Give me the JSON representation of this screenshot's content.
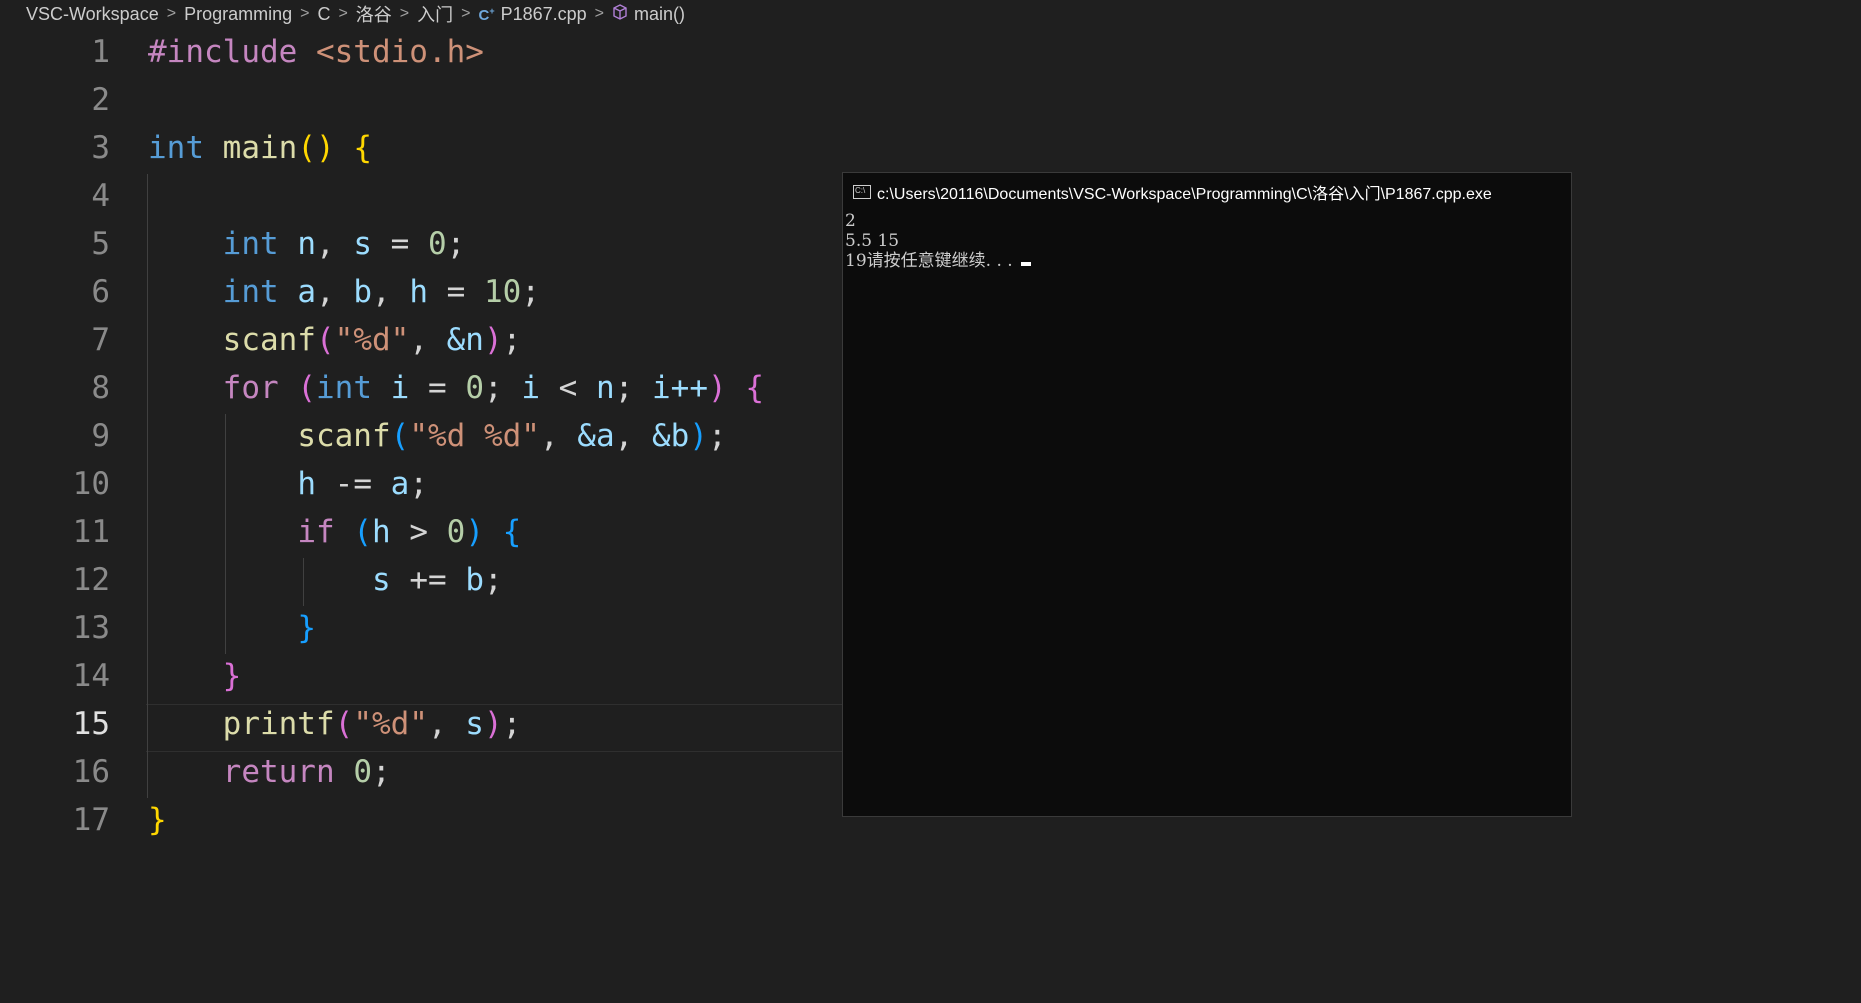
{
  "breadcrumb": {
    "items": [
      "VSC-Workspace",
      "Programming",
      "C",
      "洛谷",
      "入门",
      "P1867.cpp",
      "main()"
    ],
    "separator": ">",
    "file_icon": "cpp-file-icon",
    "symbol_icon": "cube-symbol-icon"
  },
  "editor": {
    "active_line": "15",
    "line_numbers": [
      "1",
      "2",
      "3",
      "4",
      "5",
      "6",
      "7",
      "8",
      "9",
      "10",
      "11",
      "12",
      "13",
      "14",
      "15",
      "16",
      "17"
    ],
    "code": {
      "l1_directive": "#include",
      "l1_header": "<stdio.h>",
      "l3_type": "int",
      "l3_func": "main",
      "l5_type": "int",
      "l5_n": "n",
      "l5_s": "s",
      "l5_zero": "0",
      "l6_type": "int",
      "l6_a": "a",
      "l6_b": "b",
      "l6_h": "h",
      "l6_ten": "10",
      "l7_func": "scanf",
      "l7_fmt": "\"%d\"",
      "l7_arg": "&n",
      "l8_for": "for",
      "l8_type": "int",
      "l8_i": "i",
      "l8_zero": "0",
      "l8_i2": "i",
      "l8_n": "n",
      "l8_inc": "i++",
      "l9_func": "scanf",
      "l9_fmt": "\"%d %d\"",
      "l9_a": "&a",
      "l9_b": "&b",
      "l10_h": "h",
      "l10_op": "-=",
      "l10_a": "a",
      "l11_if": "if",
      "l11_h": "h",
      "l11_zero": "0",
      "l12_s": "s",
      "l12_op": "+=",
      "l12_b": "b",
      "l15_func": "printf",
      "l15_fmt": "\"%d\"",
      "l15_s": "s",
      "l16_return": "return",
      "l16_zero": "0"
    }
  },
  "console": {
    "title": "c:\\Users\\20116\\Documents\\VSC-Workspace\\Programming\\C\\洛谷\\入门\\P1867.cpp.exe",
    "output_lines": [
      "2",
      "5.5 15",
      "19请按任意键继续. . ."
    ]
  },
  "colors": {
    "editor_bg": "#1f1f1f",
    "console_bg": "#0c0c0c",
    "keyword": "#569cd6",
    "control_keyword": "#c586c0",
    "function": "#dcdcaa",
    "string": "#ce9178",
    "number": "#b5cea8",
    "variable": "#9cdcfe"
  }
}
